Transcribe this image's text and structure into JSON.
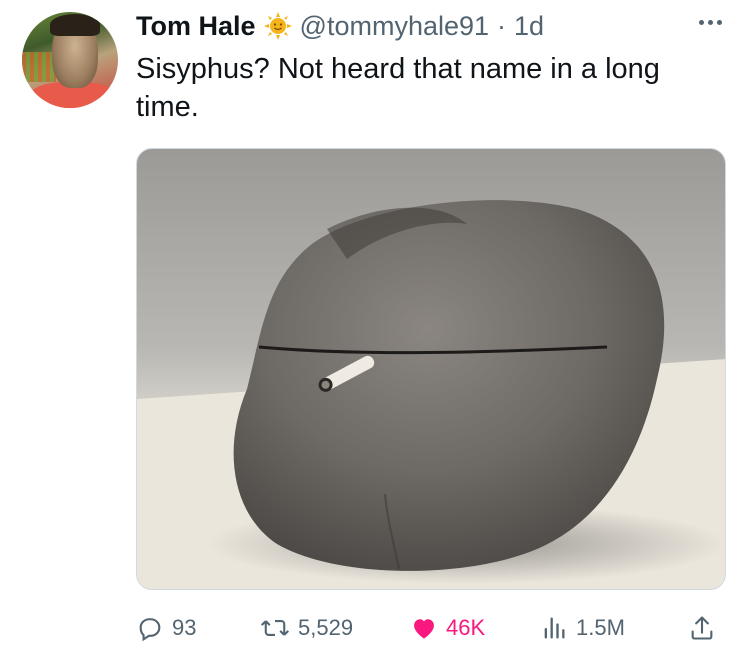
{
  "author": {
    "name": "Tom Hale",
    "badge_icon": "sun-emoji-icon",
    "handle": "@tommyhale91",
    "separator": "·",
    "time": "1d"
  },
  "tweet": {
    "text": "Sisyphus? Not heard that name in a long time."
  },
  "media": {
    "icon": "photo-stone-with-cigarette"
  },
  "actions": {
    "replies": "93",
    "retweets": "5,529",
    "likes": "46K",
    "views": "1.5M"
  },
  "colors": {
    "text": "#0f1419",
    "secondary": "#536471",
    "like": "#f91880"
  }
}
